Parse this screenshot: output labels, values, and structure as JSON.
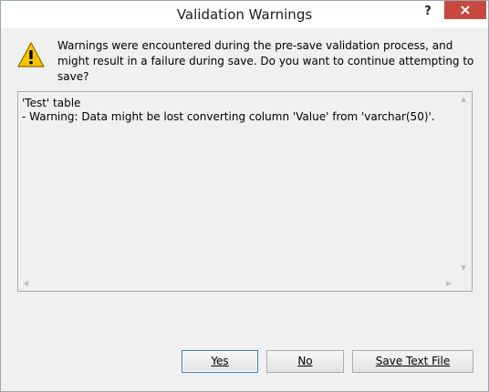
{
  "window": {
    "title": "Validation Warnings",
    "help_label": "?"
  },
  "message": {
    "text": "Warnings were encountered during the pre-save validation process, and might result in a failure during save. Do you want to continue attempting to save?",
    "icon": "warning-triangle-icon"
  },
  "details": {
    "line1": "'Test' table",
    "line2": "- Warning: Data might be lost converting column 'Value' from 'varchar(50)'."
  },
  "buttons": {
    "yes": "Yes",
    "no": "No",
    "save_text_file": "Save Text File"
  },
  "colors": {
    "close_button": "#c7483e",
    "warning_yellow": "#f5c400",
    "dialog_bg": "#f0f0f0"
  }
}
